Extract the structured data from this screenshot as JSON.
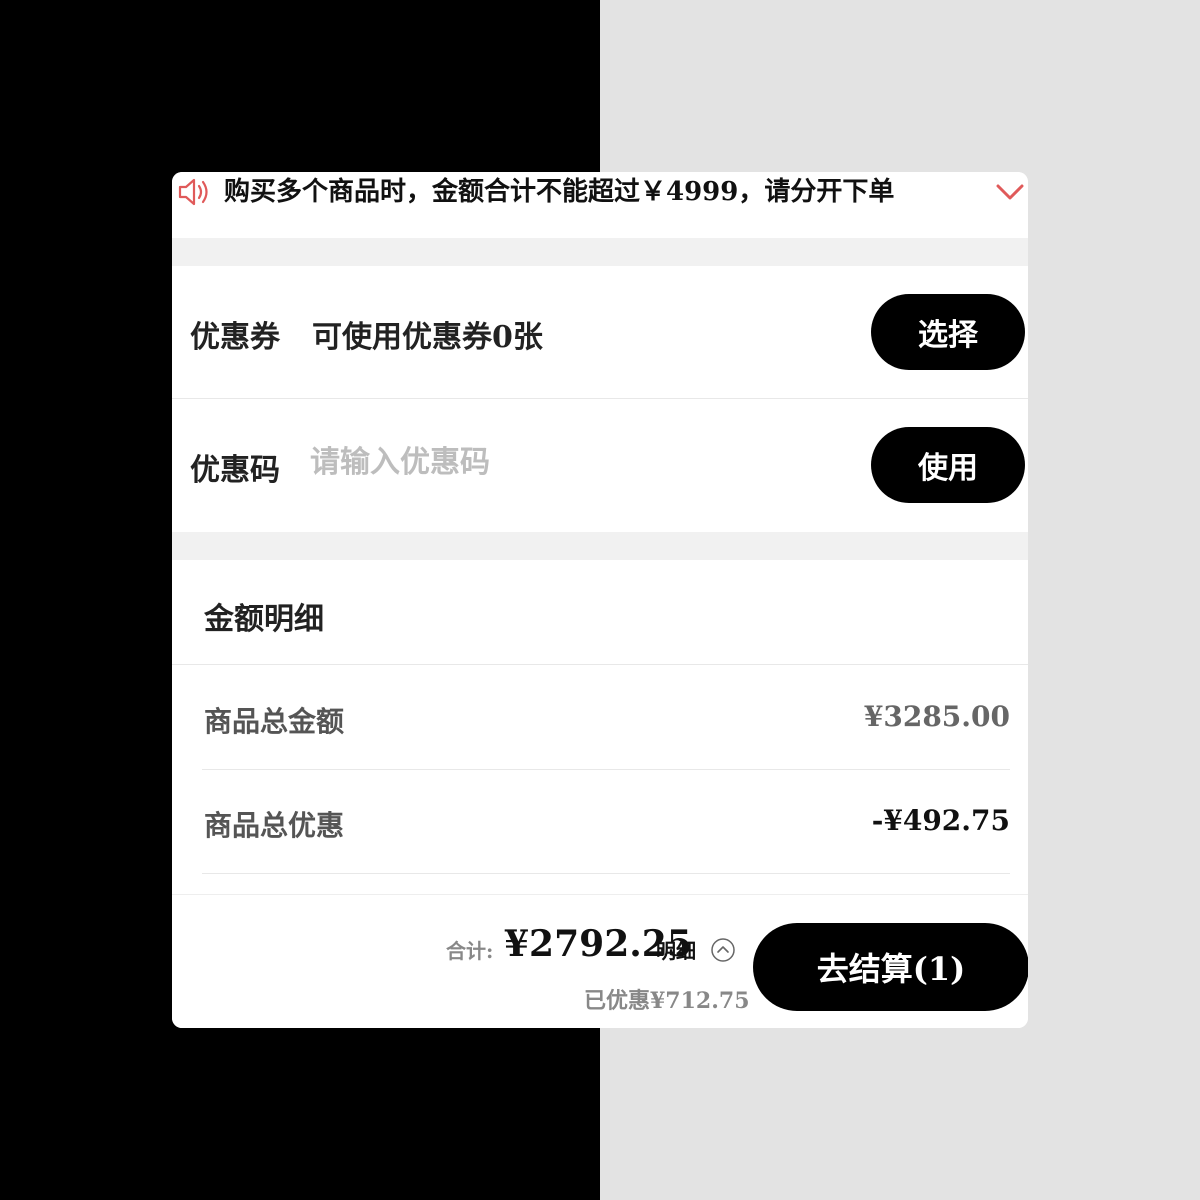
{
  "notice": {
    "text": "购买多个商品时，金额合计不能超过￥4999，请分开下单",
    "icon": "speaker-icon",
    "accent_color": "#e05a5a",
    "expand_icon": "chevron-down-icon"
  },
  "coupon": {
    "label": "优惠券",
    "value": "可使用优惠券0张",
    "button_label": "选择"
  },
  "promo_code": {
    "label": "优惠码",
    "placeholder": "请输入优惠码",
    "value": "",
    "button_label": "使用"
  },
  "amount_detail": {
    "title": "金额明细",
    "rows": [
      {
        "label": "商品总金额",
        "value": "¥3285.00"
      },
      {
        "label": "商品总优惠",
        "value": "-¥492.75"
      }
    ]
  },
  "footer": {
    "total_label": "合计:",
    "total_value": "¥2792.25",
    "detail_label": "明细",
    "saved_text": "已优惠¥712.75",
    "checkout_label": "去结算(1)"
  },
  "colors": {
    "primary_button": "#000000",
    "accent": "#e05a5a",
    "placeholder": "#bdbdbd"
  }
}
